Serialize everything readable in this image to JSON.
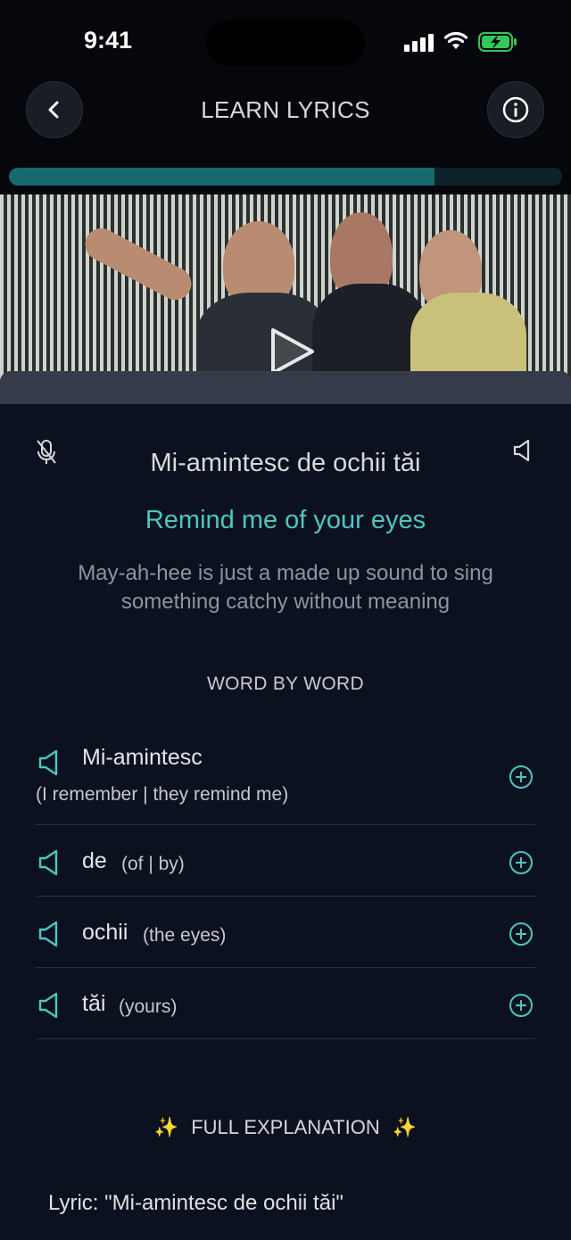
{
  "status_bar": {
    "time": "9:41",
    "colors": {
      "battery": "#34c759"
    }
  },
  "header": {
    "title": "LEARN LYRICS",
    "progress_fraction": 0.77
  },
  "video": {
    "icon": "play-icon"
  },
  "lyric": {
    "original": "Mi-amintesc de ochii tăi",
    "translation": "Remind me of your eyes",
    "note": "May-ah-hee is just a made up sound to sing something catchy without meaning"
  },
  "word_by_word": {
    "heading": "WORD BY WORD",
    "items": [
      {
        "word": "Mi-amintesc",
        "gloss": "(I remember | they remind me)"
      },
      {
        "word": "de",
        "gloss": "(of | by)"
      },
      {
        "word": "ochii",
        "gloss": "(the eyes)"
      },
      {
        "word": "tăi",
        "gloss": "(yours)"
      }
    ]
  },
  "full_explanation": {
    "heading": "FULL EXPLANATION",
    "sparkle": "✨",
    "lyric_line": "Lyric: \"Mi-amintesc de ochii tăi\""
  },
  "colors": {
    "accent": "#4cc6c0",
    "progress": "#17696e",
    "background": "#0c1120"
  }
}
